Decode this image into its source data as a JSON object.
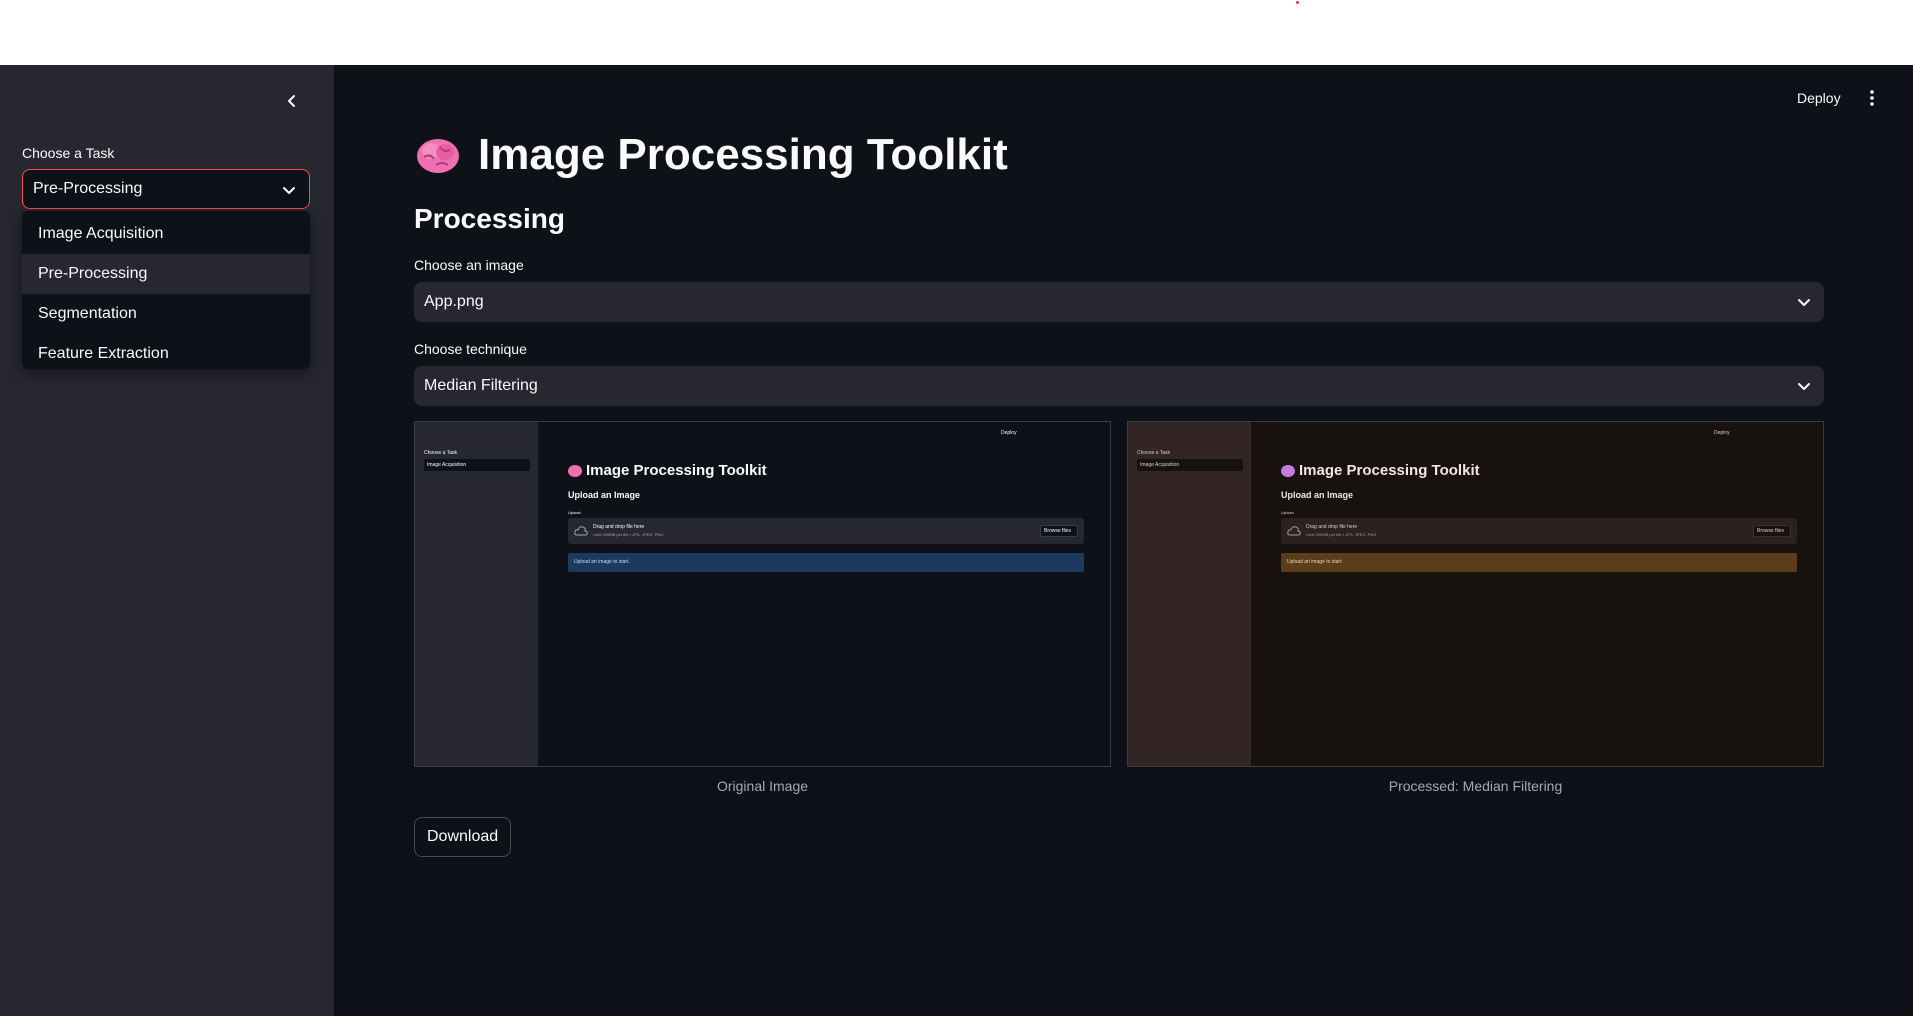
{
  "sidebar": {
    "task_label": "Choose a Task",
    "selected_task": "Pre-Processing",
    "options": [
      "Image Acquisition",
      "Pre-Processing",
      "Segmentation",
      "Feature Extraction"
    ]
  },
  "header": {
    "deploy_label": "Deploy"
  },
  "main": {
    "title": "Image Processing Toolkit",
    "subheading": "Processing",
    "image_label": "Choose an image",
    "image_value": "App.png",
    "technique_label": "Choose technique",
    "technique_value": "Median Filtering",
    "original_caption": "Original Image",
    "processed_caption": "Processed: Median Filtering",
    "download_label": "Download"
  },
  "preview": {
    "deploy": "Deploy",
    "task_label": "Choose a Task",
    "task_value": "Image Acquisition",
    "title": "Image Processing Toolkit",
    "subheading": "Upload an Image",
    "upload_label": "Upload",
    "drop_text": "Drag and drop file here",
    "limit_text": "Limit 200MB per file • JPG, JPEG, PNG",
    "browse_label": "Browse files",
    "info_text": "Upload an image to start."
  },
  "colors": {
    "accent": "#ff4b4b",
    "background": "#0e1117",
    "sidebar": "#262730",
    "info_blue": "#1c3a5e",
    "info_amber": "#5c3d1a"
  }
}
